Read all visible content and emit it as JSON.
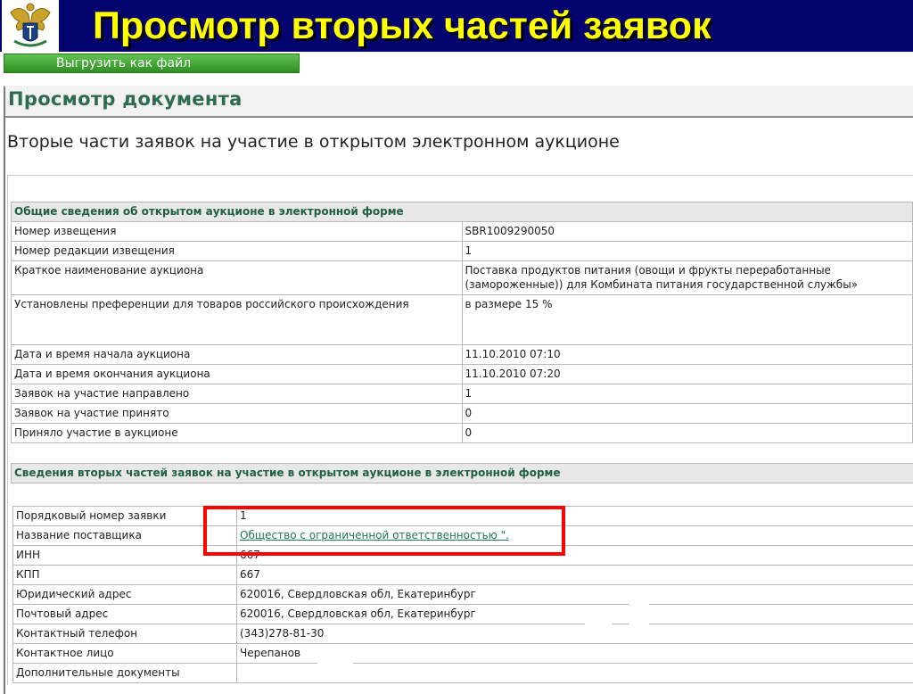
{
  "banner": {
    "title": "Просмотр вторых частей заявок",
    "logo_icon": "emblem-icon",
    "background": "#04046e",
    "title_color": "#ffff00"
  },
  "toolbar": {
    "export_label": "Выгрузить как файл"
  },
  "document": {
    "header": "Просмотр документа",
    "title": "Вторые части заявок на участие в открытом электронном аукционе"
  },
  "general": {
    "heading": "Общие сведения об открытом аукционе в электронной форме",
    "rows": [
      {
        "label": "Номер извещения",
        "value": "SBR1009290050"
      },
      {
        "label": "Номер редакции извещения",
        "value": "1"
      },
      {
        "label": "Краткое наименование аукциона",
        "value": "Поставка продуктов питания (овощи и фрукты переработанные (замороженные)) для Комбината питания государственной службы»"
      },
      {
        "label": "Установлены преференции для товаров российского происхождения",
        "value": "в размере 15 %"
      },
      {
        "label": "Дата и время начала аукциона",
        "value": "11.10.2010 07:10"
      },
      {
        "label": "Дата и время окончания аукциона",
        "value": "11.10.2010 07:20"
      },
      {
        "label": "Заявок на участие направлено",
        "value": "1"
      },
      {
        "label": "Заявок на участие принято",
        "value": "0"
      },
      {
        "label": "Приняло участие в аукционе",
        "value": "0"
      }
    ]
  },
  "second_parts": {
    "heading": "Сведения вторых частей заявок на участие в открытом аукционе в электронной форме",
    "rows": [
      {
        "label": "Порядковый номер заявки",
        "value": "1"
      },
      {
        "label": "Название поставщика",
        "value": "Общество с ограниченной ответственностью \"."
      },
      {
        "label": "ИНН",
        "value": "667"
      },
      {
        "label": "КПП",
        "value": "667"
      },
      {
        "label": "Юридический адрес",
        "value": "620016, Свердловская обл, Екатеринбург"
      },
      {
        "label": "Почтовый адрес",
        "value": "620016, Свердловская обл, Екатеринбург"
      },
      {
        "label": "Контактный телефон",
        "value": "(343)278-81-30"
      },
      {
        "label": "Контактное лицо",
        "value": "Черепанов"
      },
      {
        "label": "Дополнительные документы",
        "value": ""
      }
    ]
  },
  "highlight_color": "#ff0000"
}
